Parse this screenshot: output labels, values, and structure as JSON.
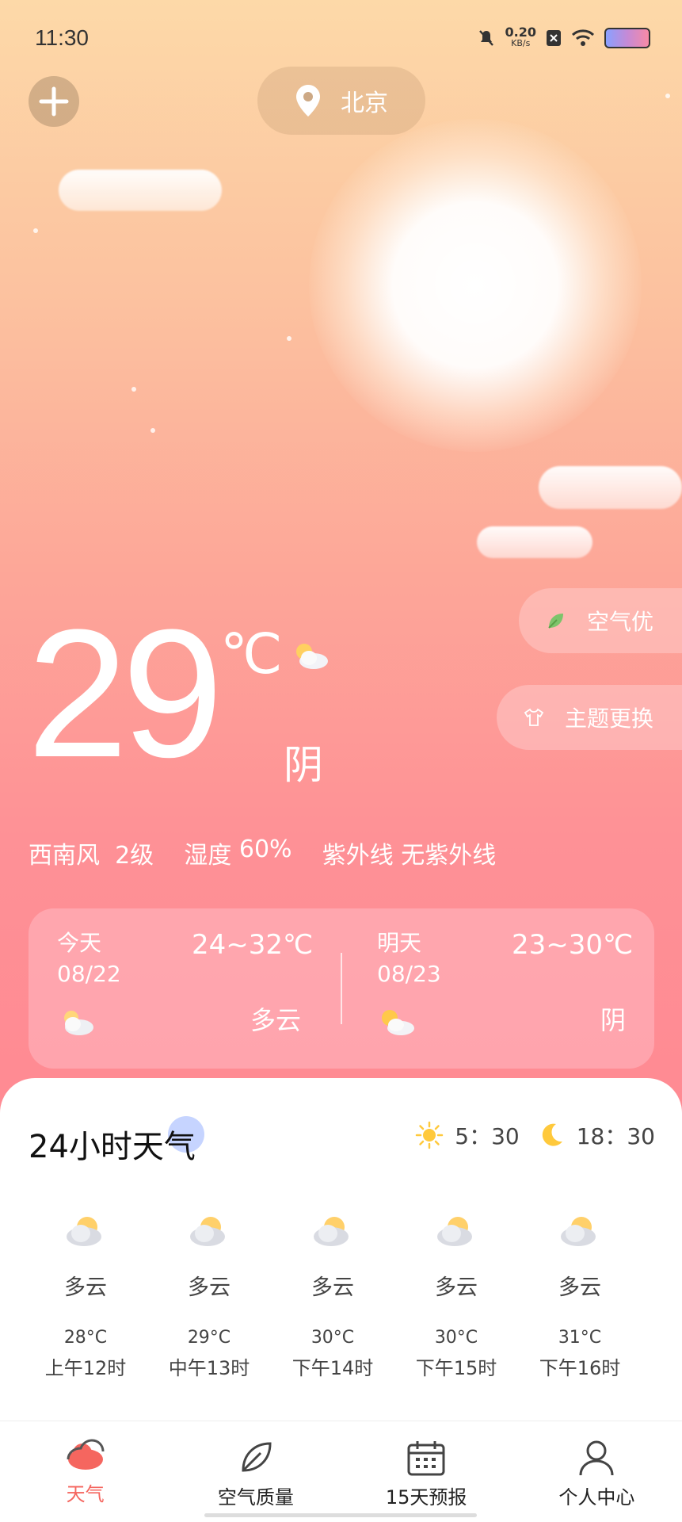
{
  "status_bar": {
    "time": "11:30",
    "net_speed_value": "0.20",
    "net_speed_unit": "KB/s"
  },
  "header": {
    "city": "北京"
  },
  "side_buttons": {
    "air_quality": "空气优",
    "theme": "主题更换"
  },
  "current": {
    "temperature": "29",
    "unit": "℃",
    "condition": "阴",
    "wind_dir": "西南风",
    "wind_level": "2级",
    "humidity_label": "湿度",
    "humidity": "60%",
    "uv_label": "紫外线",
    "uv": "无紫外线"
  },
  "days": [
    {
      "label": "今天",
      "date": "08/22",
      "range": "24~32℃",
      "desc": "多云",
      "icon": "cloudy-icon"
    },
    {
      "label": "明天",
      "date": "08/23",
      "range": "23~30℃",
      "desc": "阴",
      "icon": "partly-cloudy-icon"
    }
  ],
  "hourly": {
    "title": "24小时天气",
    "sunrise": "5：30",
    "sunset": "18：30",
    "items": [
      {
        "desc": "多云",
        "temp": "28°C",
        "time": "上午12时"
      },
      {
        "desc": "多云",
        "temp": "29°C",
        "time": "中午13时"
      },
      {
        "desc": "多云",
        "temp": "30°C",
        "time": "下午14时"
      },
      {
        "desc": "多云",
        "temp": "30°C",
        "time": "下午15时"
      },
      {
        "desc": "多云",
        "temp": "31°C",
        "time": "下午16时"
      }
    ]
  },
  "nav": [
    {
      "label": "天气",
      "icon": "weather-icon",
      "active": true
    },
    {
      "label": "空气质量",
      "icon": "leaf-icon",
      "active": false
    },
    {
      "label": "15天预报",
      "icon": "calendar-icon",
      "active": false
    },
    {
      "label": "个人中心",
      "icon": "user-icon",
      "active": false
    }
  ],
  "colors": {
    "accent": "#f5665f",
    "bg_top": "#fdd9a8",
    "bg_bottom": "#ff8b93"
  }
}
